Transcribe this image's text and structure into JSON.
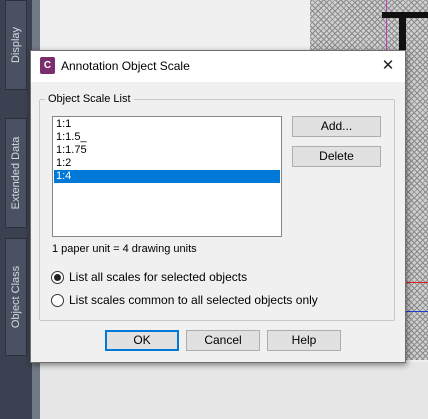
{
  "palette": {
    "tabs": [
      {
        "label": "Display"
      },
      {
        "label": "Extended Data"
      },
      {
        "label": "Object Class"
      }
    ]
  },
  "dialog": {
    "icon_glyph": "C",
    "title": "Annotation Object Scale",
    "close_glyph": "✕",
    "group_title": "Object Scale List",
    "scales": [
      {
        "label": "1:1",
        "selected": false
      },
      {
        "label": "1:1.5_",
        "selected": false
      },
      {
        "label": "1:1.75",
        "selected": false
      },
      {
        "label": "1:2",
        "selected": false
      },
      {
        "label": "1:4",
        "selected": true
      }
    ],
    "add_label": "Add...",
    "delete_label": "Delete",
    "units_text": "1 paper unit = 4 drawing units",
    "radio_all_label": "List all scales for selected objects",
    "radio_all_checked": true,
    "radio_common_label": "List scales common to all selected objects only",
    "radio_common_checked": false,
    "ok_label": "OK",
    "cancel_label": "Cancel",
    "help_label": "Help"
  },
  "colors": {
    "selection": "#0078d7",
    "icon_bg": "#7b2e6e"
  }
}
